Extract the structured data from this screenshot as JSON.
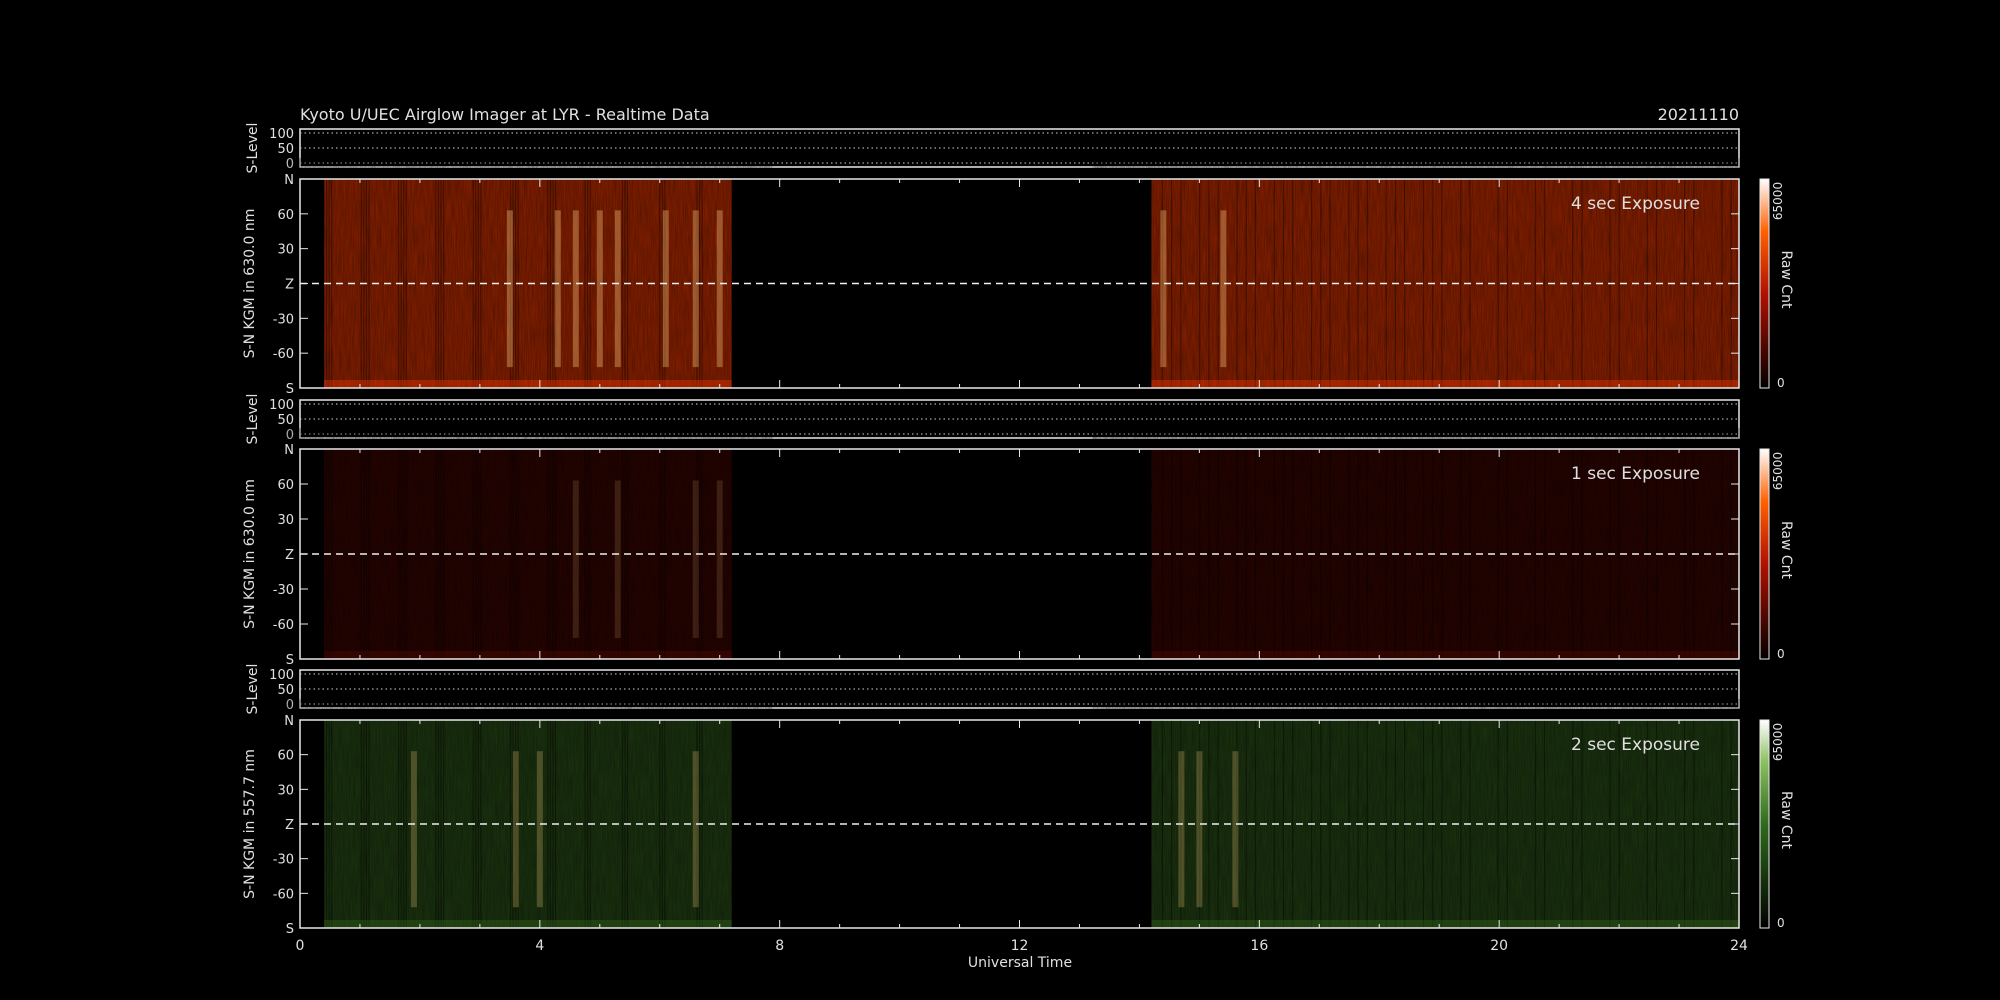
{
  "header": {
    "title": "Kyoto U/UEC Airglow Imager at LYR - Realtime Data",
    "date": "20211110"
  },
  "x_axis": {
    "label": "Universal Time",
    "range": [
      0,
      24
    ],
    "ticks": [
      "0",
      "4",
      "8",
      "12",
      "16",
      "20",
      "24"
    ]
  },
  "colorbar": {
    "label": "Raw Cnt",
    "max_label": "65000",
    "min_label": "0"
  },
  "chart_data": [
    {
      "type": "line",
      "panel": "s-level-1",
      "ylabel": "S-Level",
      "yticks": [
        "100",
        "50",
        "0"
      ],
      "ylim": [
        0,
        100
      ],
      "grid": true,
      "series": []
    },
    {
      "type": "heatmap",
      "panel": "keogram-630-4s",
      "annotation": "4 sec Exposure",
      "ylabel": "S-N KGM in 630.0 nm",
      "yticks": [
        "N",
        "60",
        "30",
        "Z",
        "-30",
        "-60",
        "S"
      ],
      "colormap_color": "#ff3c00",
      "intensity_scale": 1.0,
      "data_intervals_ut": [
        [
          0.4,
          7.2
        ],
        [
          14.2,
          24.0
        ]
      ],
      "bright_columns_ut": [
        3.5,
        4.3,
        4.6,
        5.0,
        5.3,
        6.1,
        6.6,
        7.0,
        14.4,
        15.4
      ]
    },
    {
      "type": "line",
      "panel": "s-level-2",
      "ylabel": "S-Level",
      "yticks": [
        "100",
        "50",
        "0"
      ],
      "ylim": [
        0,
        100
      ],
      "grid": true,
      "series": []
    },
    {
      "type": "heatmap",
      "panel": "keogram-630-1s",
      "annotation": "1 sec Exposure",
      "ylabel": "S-N KGM in 630.0 nm",
      "yticks": [
        "N",
        "60",
        "30",
        "Z",
        "-30",
        "-60",
        "S"
      ],
      "colormap_color": "#b01400",
      "intensity_scale": 0.4,
      "data_intervals_ut": [
        [
          0.4,
          7.2
        ],
        [
          14.2,
          24.0
        ]
      ],
      "bright_columns_ut": [
        4.6,
        5.3,
        6.6,
        7.0
      ]
    },
    {
      "type": "line",
      "panel": "s-level-3",
      "ylabel": "S-Level",
      "yticks": [
        "100",
        "50",
        "0"
      ],
      "ylim": [
        0,
        100
      ],
      "grid": true,
      "series": []
    },
    {
      "type": "heatmap",
      "panel": "keogram-557-2s",
      "annotation": "2 sec Exposure",
      "ylabel": "S-N KGM in 557.7 nm",
      "yticks": [
        "N",
        "60",
        "30",
        "Z",
        "-30",
        "-60",
        "S"
      ],
      "colormap_color": "#4a8a2a",
      "intensity_scale": 0.7,
      "data_intervals_ut": [
        [
          0.4,
          7.2
        ],
        [
          14.2,
          24.0
        ]
      ],
      "bright_columns_ut": [
        1.9,
        3.6,
        4.0,
        6.6,
        14.7,
        15.0,
        15.6
      ]
    }
  ]
}
